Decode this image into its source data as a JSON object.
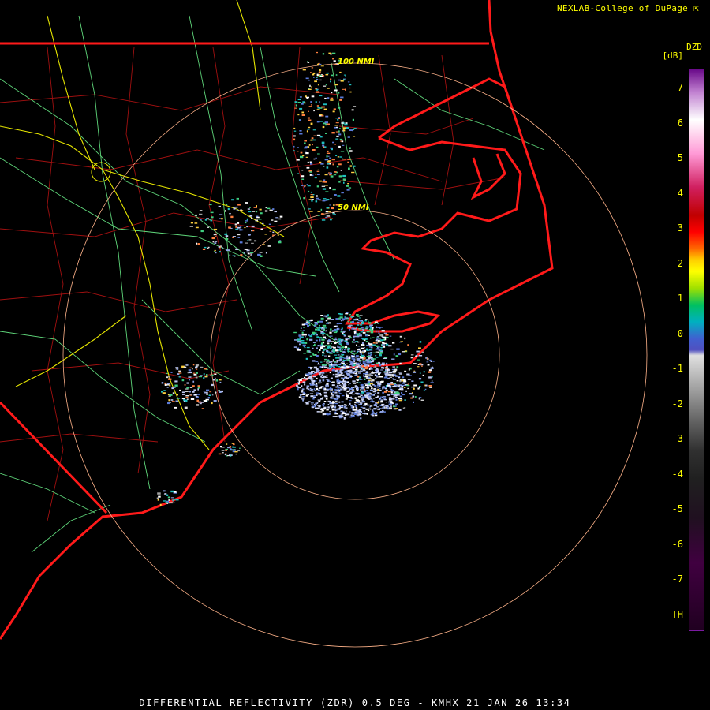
{
  "credit": {
    "text": "NEXLAB-College of DuPage",
    "icon": "arrow-icon"
  },
  "legend": {
    "title": "DZD",
    "unit": "[dB]",
    "ticks": [
      "7",
      "6",
      "5",
      "4",
      "3",
      "2",
      "1",
      "0",
      "-1",
      "-2",
      "-3",
      "-4",
      "-5",
      "-6",
      "-7",
      "TH"
    ]
  },
  "range_rings": {
    "inner": "50 NMI",
    "outer": "100 NMI"
  },
  "caption": "DIFFERENTIAL REFLECTIVITY (ZDR) 0.5 DEG - KMHX 21 JAN 26 13:34",
  "colors": {
    "background": "#000000",
    "state_border": "#ff1a1a",
    "county": "#a01010",
    "highway": "#5fd67a",
    "interstate": "#e6e600",
    "ring": "#ffb38a",
    "text": "#ffff00"
  }
}
